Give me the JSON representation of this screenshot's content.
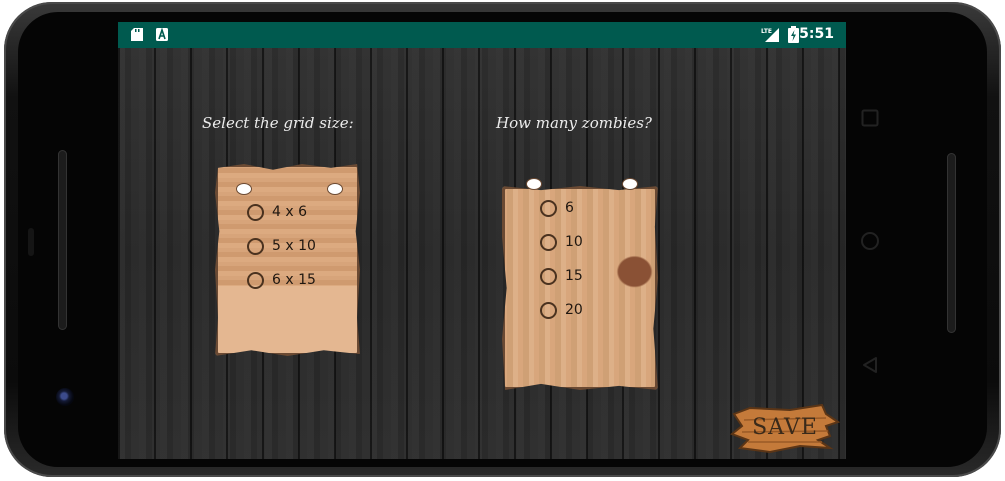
{
  "status_bar": {
    "time": "5:51",
    "left_icons": [
      "sd-card-icon",
      "a-icon"
    ],
    "right_icons": [
      "lte-signal-icon",
      "battery-charging-icon"
    ]
  },
  "grid_panel": {
    "prompt": "Select the grid size:",
    "options": [
      "4 x 6",
      "5 x 10",
      "6 x 15"
    ]
  },
  "zombie_panel": {
    "prompt": "How many zombies?",
    "options": [
      "6",
      "10",
      "15",
      "20"
    ]
  },
  "save_button": {
    "label": "SAVE"
  },
  "nav_bar": {
    "buttons": [
      "overview-icon",
      "home-icon",
      "back-icon"
    ]
  },
  "colors": {
    "status_bar": "#005a4f",
    "wood_dark": "#2a2a2a",
    "paper": "#d8a67c",
    "save_text": "#3a2a1a"
  }
}
